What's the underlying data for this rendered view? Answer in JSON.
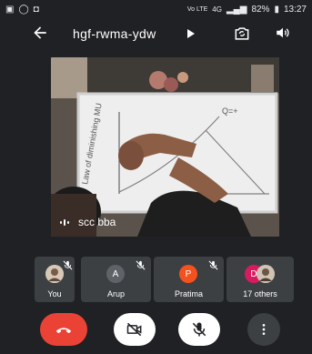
{
  "status_bar": {
    "network_label": "Vo LTE",
    "signal_label": "4G",
    "battery": "82%",
    "time": "13:27"
  },
  "header": {
    "meeting_code": "hgf-rwma-ydw",
    "icons": [
      "back-arrow-icon",
      "caret-right-icon",
      "switch-camera-icon",
      "speaker-icon"
    ]
  },
  "main_video": {
    "participant_name": "scc bba",
    "board_text": "Law of diminishing MU"
  },
  "participants": [
    {
      "label": "You",
      "avatar": "photo",
      "muted": true
    },
    {
      "label": "Arup",
      "avatar_letter": "A",
      "avatar_color": "#5f6368",
      "muted": true
    },
    {
      "label": "Pratima",
      "avatar_letter": "P",
      "avatar_color": "#f4511e",
      "muted": true
    },
    {
      "label": "17 others",
      "avatar_letter": "D",
      "avatar_color": "#d81b60",
      "muted": false
    }
  ],
  "controls": {
    "end_call_color": "#ea4335",
    "icons": [
      "end-call-icon",
      "camera-off-icon",
      "mic-off-icon",
      "more-options-icon"
    ]
  }
}
